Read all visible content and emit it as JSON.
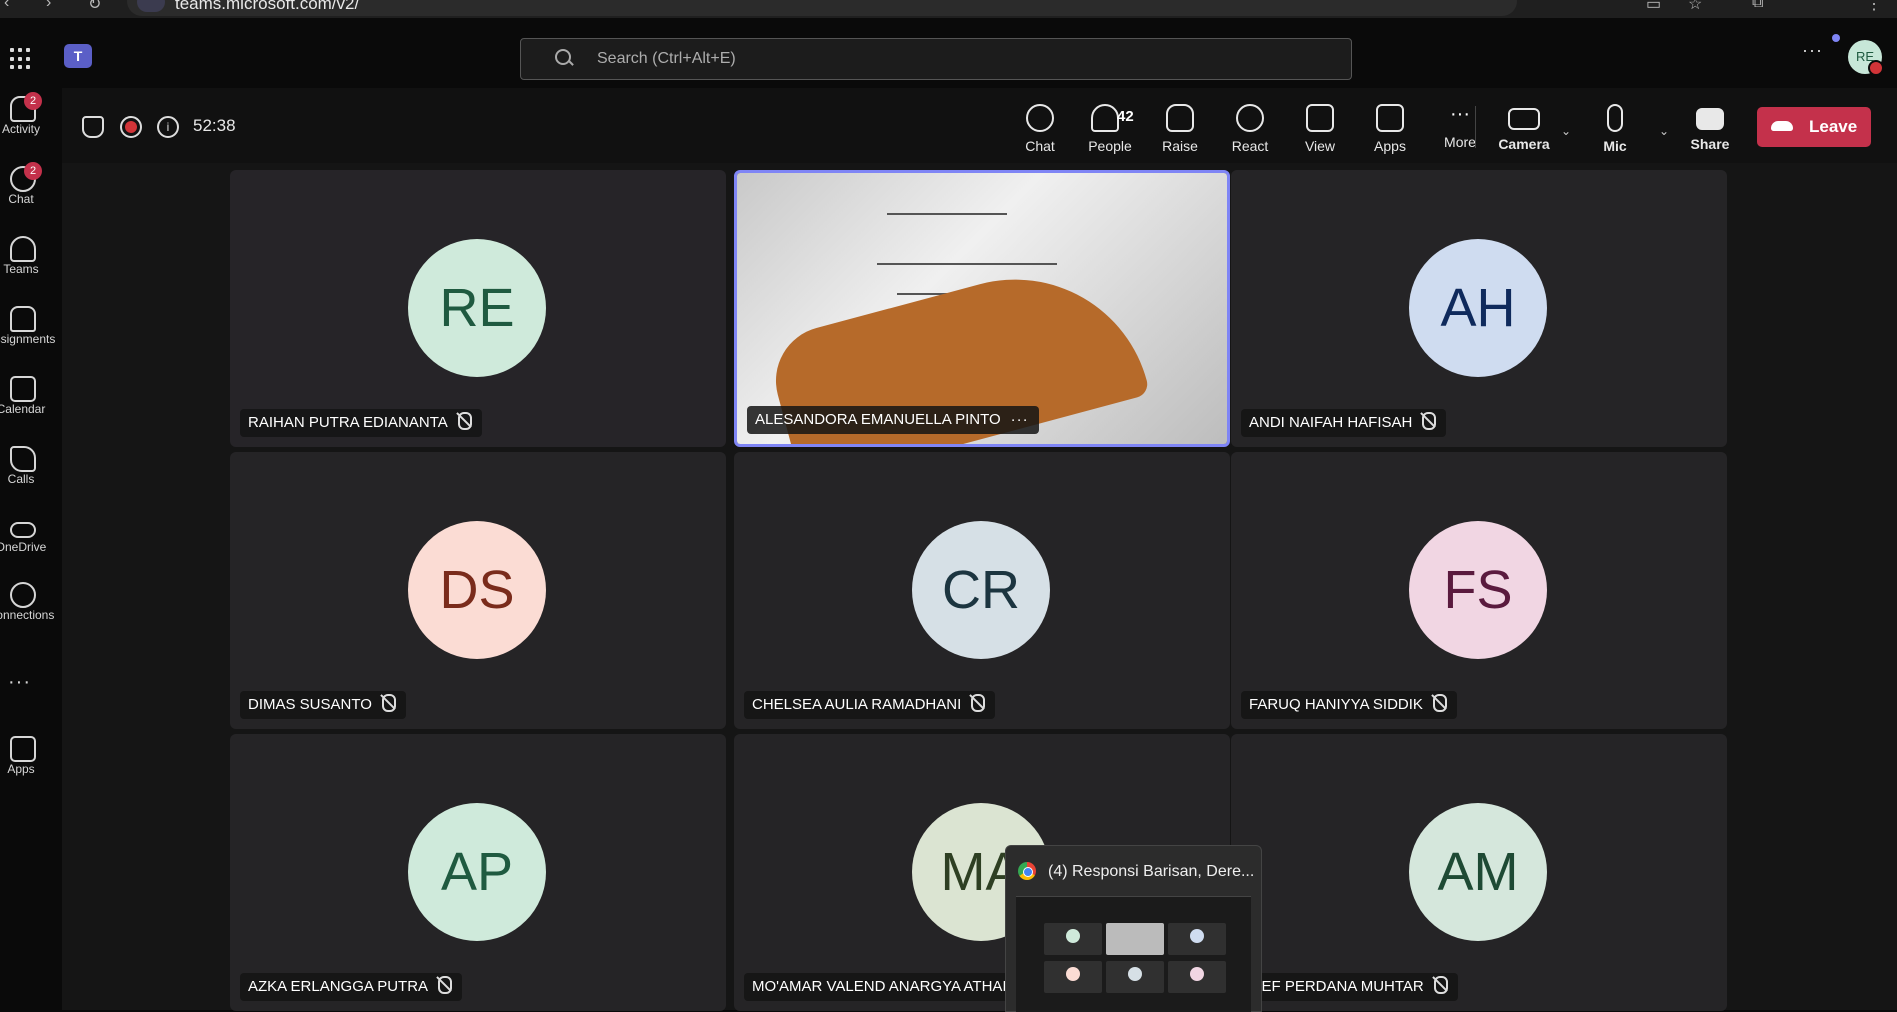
{
  "browser": {
    "url": "teams.microsoft.com/v2/"
  },
  "header": {
    "search_placeholder": "Search (Ctrl+Alt+E)",
    "avatar_initials": "RE"
  },
  "rail": {
    "items": [
      {
        "label": "Activity",
        "badge": "2"
      },
      {
        "label": "Chat",
        "badge": "2"
      },
      {
        "label": "Teams"
      },
      {
        "label": "Assignments"
      },
      {
        "label": "Calendar"
      },
      {
        "label": "Calls"
      },
      {
        "label": "OneDrive"
      },
      {
        "label": "Connections"
      },
      {
        "label": "Apps"
      }
    ]
  },
  "meeting": {
    "timer": "52:38",
    "toolbar": {
      "chat": "Chat",
      "people": "People",
      "people_count": "42",
      "raise": "Raise",
      "react": "React",
      "view": "View",
      "apps": "Apps",
      "more": "More",
      "camera": "Camera",
      "mic": "Mic",
      "share": "Share",
      "leave": "Leave"
    }
  },
  "participants": [
    {
      "name": "RAIHAN PUTRA EDIANANTA",
      "initials": "RE",
      "bg": "#cfeadb",
      "fg": "#1f5a40",
      "muted": true
    },
    {
      "name": "ALESANDORA EMANUELLA PINTO",
      "initials": "",
      "video": true,
      "muted": false
    },
    {
      "name": "ANDI NAIFAH HAFISAH",
      "initials": "AH",
      "bg": "#cfdcf0",
      "fg": "#0f2a5c",
      "muted": true
    },
    {
      "name": "DIMAS SUSANTO",
      "initials": "DS",
      "bg": "#fbdcd4",
      "fg": "#7a2b1b",
      "muted": true
    },
    {
      "name": "CHELSEA AULIA RAMADHANI",
      "initials": "CR",
      "bg": "#d6e0e6",
      "fg": "#1c3540",
      "muted": true
    },
    {
      "name": "FARUQ HANIYYA SIDDIK",
      "initials": "FS",
      "bg": "#f1d6e3",
      "fg": "#5a1a3e",
      "muted": true
    },
    {
      "name": "AZKA ERLANGGA PUTRA",
      "initials": "AP",
      "bg": "#cfeadb",
      "fg": "#1f5a40",
      "muted": true
    },
    {
      "name": "MO'AMAR VALEND ANARGYA ATHAILA",
      "initials": "MA",
      "bg": "#dbe4d2",
      "fg": "#2e3f23",
      "muted": true
    },
    {
      "name": "LIEF PERDANA MUHTAR",
      "initials": "AM",
      "bg": "#d5e7dc",
      "fg": "#1e4a34",
      "muted": true
    }
  ],
  "taskbar_popup": {
    "title": "(4) Responsi Barisan, Dere..."
  }
}
